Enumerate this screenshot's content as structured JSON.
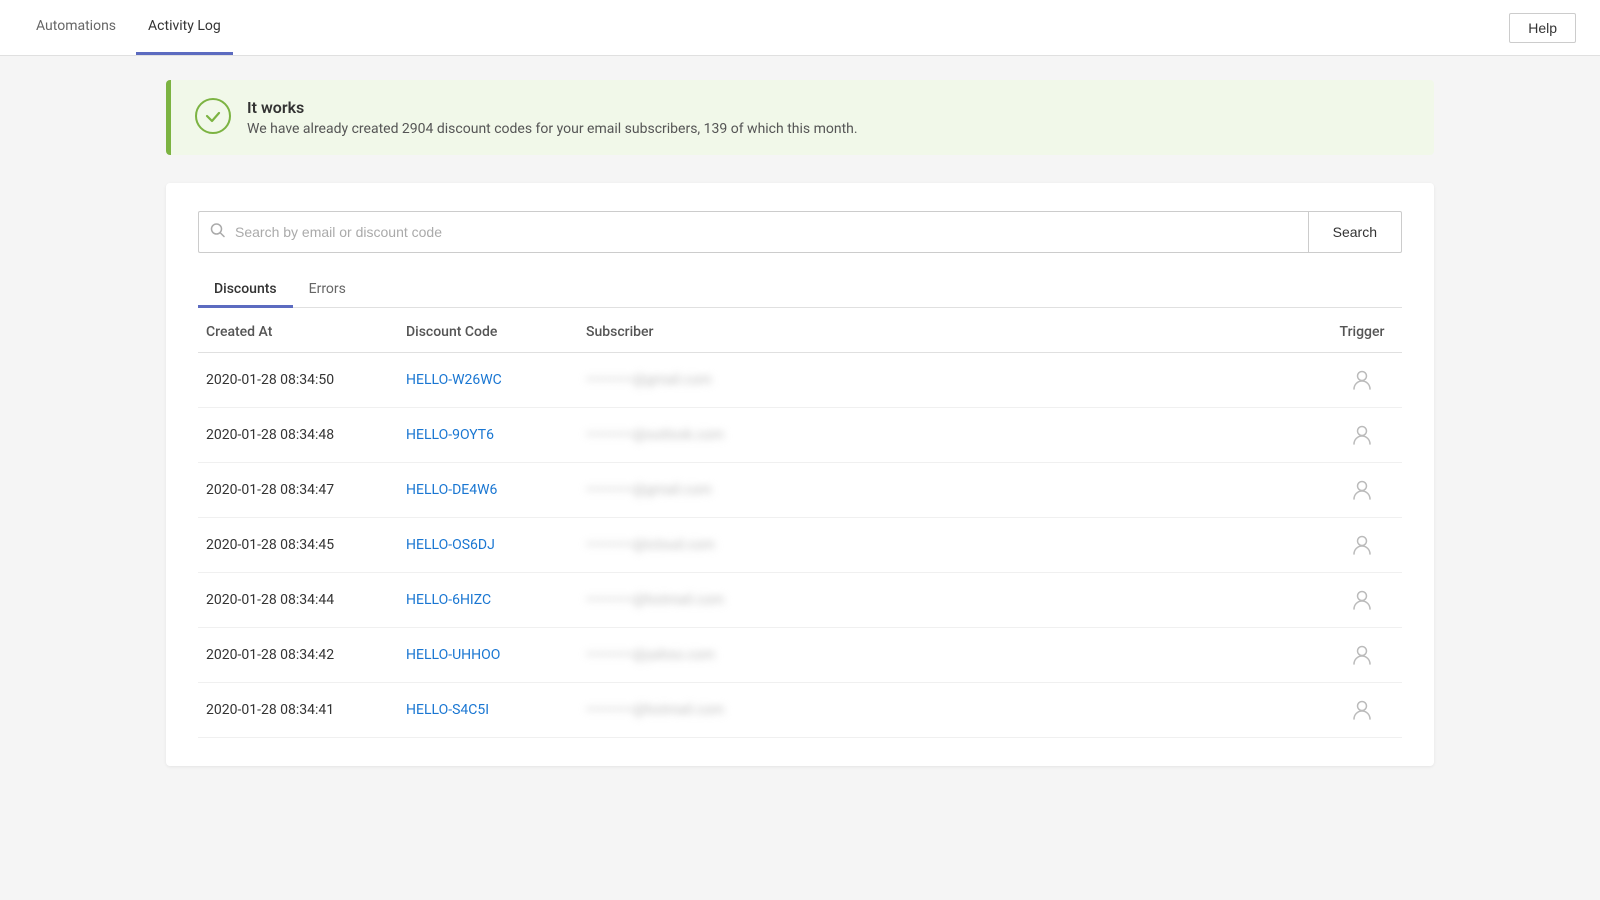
{
  "nav": {
    "tabs": [
      {
        "label": "Automations",
        "active": false
      },
      {
        "label": "Activity Log",
        "active": true
      }
    ],
    "help_button": "Help"
  },
  "banner": {
    "title": "It works",
    "description": "We have already created 2904 discount codes for your email subscribers, 139 of which this month."
  },
  "search": {
    "placeholder": "Search by email or discount code",
    "button_label": "Search"
  },
  "sub_tabs": [
    {
      "label": "Discounts",
      "active": true
    },
    {
      "label": "Errors",
      "active": false
    }
  ],
  "table": {
    "headers": [
      "Created At",
      "Discount Code",
      "Subscriber",
      "Trigger"
    ],
    "rows": [
      {
        "created_at": "2020-01-28 08:34:50",
        "discount_code": "HELLO-W26WC",
        "subscriber": "••••••••••@gmail.com",
        "trigger": "person"
      },
      {
        "created_at": "2020-01-28 08:34:48",
        "discount_code": "HELLO-9OYT6",
        "subscriber": "••••••••••@outlook.com",
        "trigger": "person"
      },
      {
        "created_at": "2020-01-28 08:34:47",
        "discount_code": "HELLO-DE4W6",
        "subscriber": "••••••••••@gmail.com",
        "trigger": "person"
      },
      {
        "created_at": "2020-01-28 08:34:45",
        "discount_code": "HELLO-OS6DJ",
        "subscriber": "••••••••••@icloud.com",
        "trigger": "person"
      },
      {
        "created_at": "2020-01-28 08:34:44",
        "discount_code": "HELLO-6HIZC",
        "subscriber": "••••••••••@hotmail.com",
        "trigger": "person"
      },
      {
        "created_at": "2020-01-28 08:34:42",
        "discount_code": "HELLO-UHHOO",
        "subscriber": "••••••••••@yahoo.com",
        "trigger": "person"
      },
      {
        "created_at": "2020-01-28 08:34:41",
        "discount_code": "HELLO-S4C5I",
        "subscriber": "••••••••••@hotmail.com",
        "trigger": "person"
      }
    ]
  }
}
